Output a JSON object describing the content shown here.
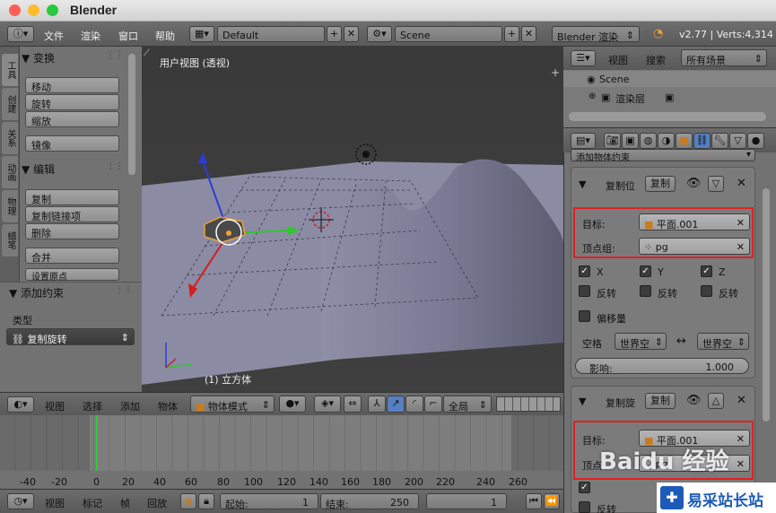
{
  "window": {
    "title": "Blender"
  },
  "topbar": {
    "menus": [
      "文件",
      "渲染",
      "窗口",
      "帮助"
    ],
    "layout": "Default",
    "scene": "Scene",
    "engine": "Blender 渲染",
    "version_info": "v2.77 | Verts:4,314"
  },
  "left_panel": {
    "tabs": [
      "工具",
      "创建",
      "关系",
      "动画",
      "物理",
      "蜡笔"
    ],
    "transform": {
      "header": "▼ 变换",
      "buttons": [
        "移动",
        "旋转",
        "缩放",
        "镜像"
      ]
    },
    "edit": {
      "header": "▼ 编辑",
      "buttons": [
        "复制",
        "复制链接项",
        "删除",
        "合并",
        "设置原点"
      ]
    },
    "add_constraint": {
      "header": "▼ 添加约束",
      "type_label": "类型",
      "type_value": "复制旋转"
    }
  },
  "viewport": {
    "label": "用户视图 (透视)",
    "object_label": "(1) 立方体"
  },
  "viewport_header": {
    "menus": [
      "视图",
      "选择",
      "添加",
      "物体"
    ],
    "mode": "物体模式",
    "orientation": "全局"
  },
  "timeline": {
    "ticks": [
      "-40",
      "-20",
      "0",
      "20",
      "40",
      "60",
      "80",
      "100",
      "120",
      "140",
      "160",
      "180",
      "200",
      "220",
      "240",
      "260"
    ],
    "current_frame": 1
  },
  "timeline_header": {
    "menus": [
      "视图",
      "标记",
      "帧",
      "回放"
    ],
    "start_label": "起始:",
    "start_value": "1",
    "end_label": "结束:",
    "end_value": "250",
    "frame_value": "1"
  },
  "outliner": {
    "menus": [
      "视图",
      "搜索"
    ],
    "filter": "所有场景",
    "items": [
      "Scene",
      "渲染层"
    ]
  },
  "properties": {
    "add_constraint": "添加物体约束",
    "copy_location": {
      "name": "复制位",
      "copy_btn": "复制",
      "target_label": "目标:",
      "target_value": "平面.001",
      "vgroup_label": "顶点组:",
      "vgroup_value": "pg",
      "axes": [
        "X",
        "Y",
        "Z"
      ],
      "invert": [
        "反转",
        "反转",
        "反转"
      ],
      "offset": "偏移量",
      "space_label": "空格",
      "space_from": "世界空",
      "space_to": "世界空",
      "influence_label": "影响:",
      "influence_value": "1.000"
    },
    "copy_rotation": {
      "name": "复制旋",
      "copy_btn": "复制",
      "target_label": "目标:",
      "target_value": "平面.001",
      "vgroup_label": "顶点",
      "vgroup_value": "pg",
      "invert": [
        "反转"
      ]
    }
  },
  "watermark": {
    "brand": "Baidu 经验",
    "site": "易采站长站"
  },
  "colors": {
    "accent_red": "#e02020",
    "green_frame": "#37c837",
    "x_axis": "#d21e1e",
    "y_axis": "#2ec82e",
    "z_axis": "#2b3dd8"
  }
}
